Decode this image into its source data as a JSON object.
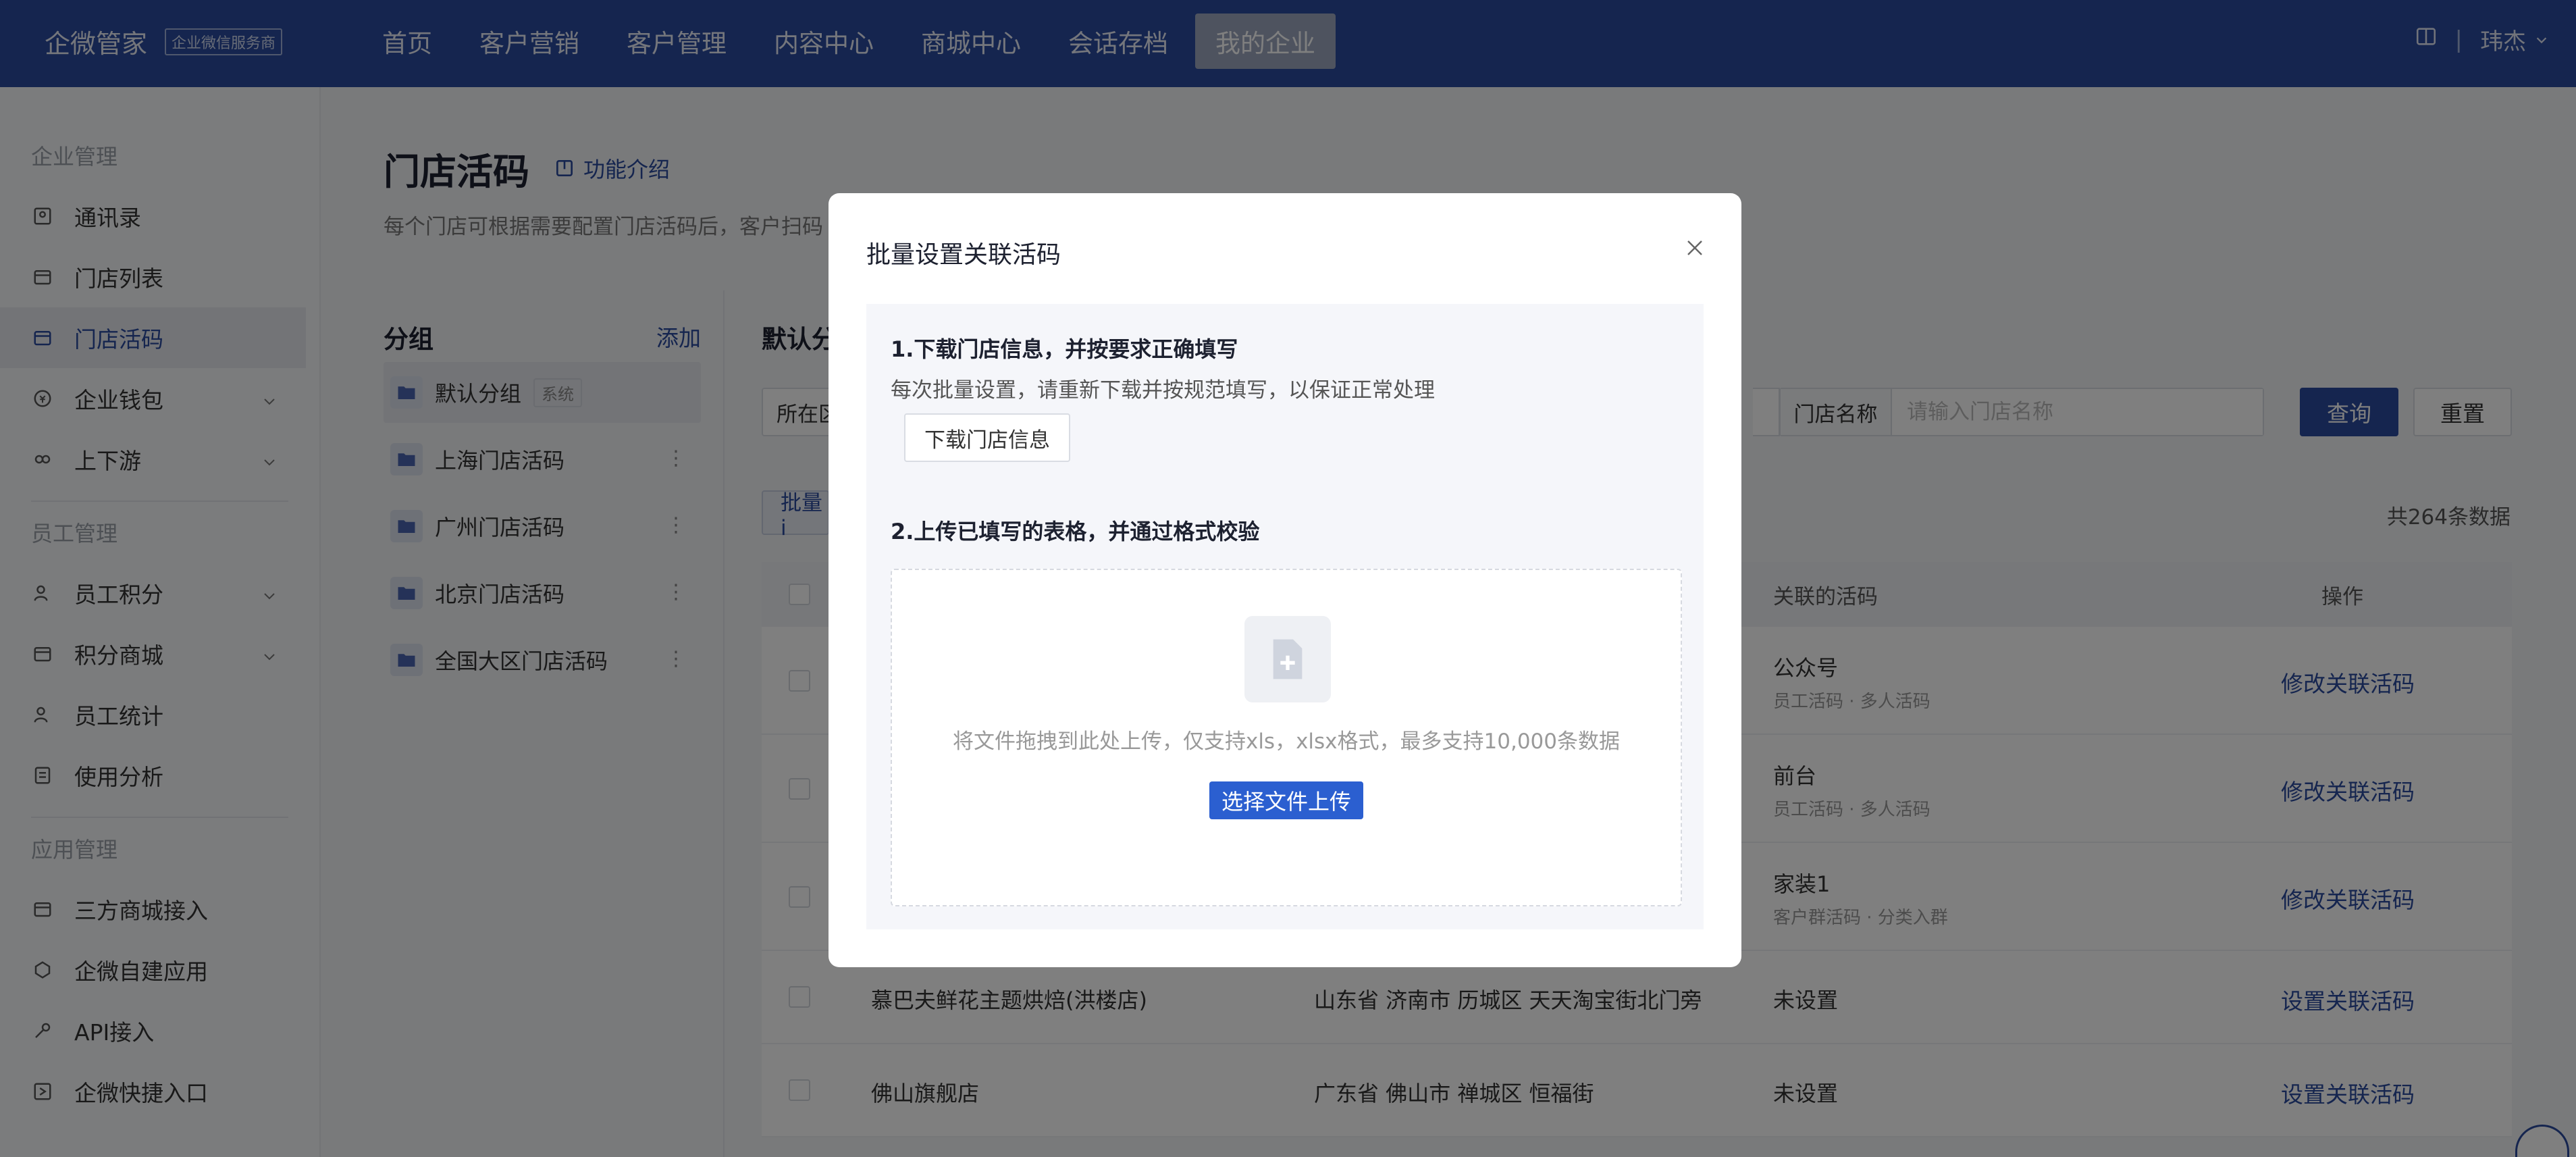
{
  "brand": {
    "name": "企微管家",
    "badge": "企业微信服务商"
  },
  "nav": {
    "items": [
      "首页",
      "客户营销",
      "客户管理",
      "内容中心",
      "商城中心",
      "会话存档",
      "我的企业"
    ],
    "active_index": 6,
    "user": "玮杰",
    "separator": "|"
  },
  "sidebar": {
    "sections": [
      {
        "title": "企业管理",
        "items": [
          {
            "label": "通讯录",
            "icon": "contacts-icon",
            "chevron": false
          },
          {
            "label": "门店列表",
            "icon": "store-icon",
            "chevron": false
          },
          {
            "label": "门店活码",
            "icon": "store-qr-icon",
            "chevron": false,
            "active": true
          },
          {
            "label": "企业钱包",
            "icon": "wallet-icon",
            "chevron": true
          },
          {
            "label": "上下游",
            "icon": "link-icon",
            "chevron": true
          }
        ]
      },
      {
        "title": "员工管理",
        "items": [
          {
            "label": "员工积分",
            "icon": "user-points-icon",
            "chevron": true
          },
          {
            "label": "积分商城",
            "icon": "mall-icon",
            "chevron": true
          },
          {
            "label": "员工统计",
            "icon": "user-stats-icon",
            "chevron": false
          },
          {
            "label": "使用分析",
            "icon": "analysis-icon",
            "chevron": false
          }
        ]
      },
      {
        "title": "应用管理",
        "items": [
          {
            "label": "三方商城接入",
            "icon": "third-party-mall-icon",
            "chevron": false
          },
          {
            "label": "企微自建应用",
            "icon": "custom-app-icon",
            "chevron": false
          },
          {
            "label": "API接入",
            "icon": "api-icon",
            "chevron": false
          },
          {
            "label": "企微快捷入口",
            "icon": "shortcut-icon",
            "chevron": false
          }
        ]
      }
    ]
  },
  "page": {
    "title": "门店活码",
    "func_intro": "功能介绍",
    "description": "每个门店可根据需要配置门店活码后，客户扫码"
  },
  "groups": {
    "title": "分组",
    "add_label": "添加",
    "items": [
      {
        "label": "默认分组",
        "tag": "系统",
        "active": true
      },
      {
        "label": "上海门店活码"
      },
      {
        "label": "广州门店活码"
      },
      {
        "label": "北京门店活码"
      },
      {
        "label": "全国大区门店活码"
      }
    ]
  },
  "content": {
    "group_label": "默认分",
    "region_filter": "所在区",
    "store_name_label": "门店名称",
    "store_name_placeholder": "请输入门店名称",
    "query_label": "查询",
    "reset_label": "重置",
    "batch_label": "批量i",
    "total": "共264条数据",
    "table": {
      "col_linked": "关联的活码",
      "col_op": "操作",
      "rows": [
        {
          "name": "",
          "addr": "",
          "linked": "公众号",
          "sub": "员工活码 · 多人活码",
          "op": "修改关联活码"
        },
        {
          "name": "",
          "addr": "",
          "linked": "前台",
          "sub": "员工活码 · 多人活码",
          "op": "修改关联活码"
        },
        {
          "name": "",
          "addr": "",
          "linked": "家装1",
          "sub": "客户群活码 · 分类入群",
          "op": "修改关联活码"
        },
        {
          "name": "慕巴夫鲜花主题烘焙(洪楼店)",
          "addr": "山东省 济南市 历城区 天天淘宝街北门旁",
          "linked": "未设置",
          "sub": "",
          "op": "设置关联活码"
        },
        {
          "name": "佛山旗舰店",
          "addr": "广东省 佛山市 禅城区 恒福街",
          "linked": "未设置",
          "sub": "",
          "op": "设置关联活码"
        }
      ]
    }
  },
  "modal": {
    "title": "批量设置关联活码",
    "step1": {
      "title": "1.下载门店信息，并按要求正确填写",
      "desc": "每次批量设置，请重新下载并按规范填写，以保证正常处理",
      "button": "下载门店信息"
    },
    "step2": {
      "title": "2.上传已填写的表格，并通过格式校验",
      "drop_text": "将文件拖拽到此处上传，仅支持xls，xlsx格式，最多支持10,000条数据",
      "button": "选择文件上传"
    }
  },
  "colors": {
    "brand": "#2b4a9e",
    "upload_button": "#2b5fd0"
  }
}
